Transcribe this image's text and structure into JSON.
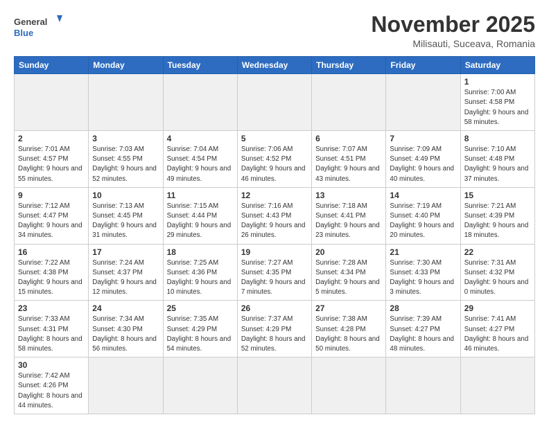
{
  "logo": {
    "text_general": "General",
    "text_blue": "Blue"
  },
  "header": {
    "month": "November 2025",
    "location": "Milisauti, Suceava, Romania"
  },
  "weekdays": [
    "Sunday",
    "Monday",
    "Tuesday",
    "Wednesday",
    "Thursday",
    "Friday",
    "Saturday"
  ],
  "weeks": [
    {
      "days": [
        {
          "num": "",
          "info": ""
        },
        {
          "num": "",
          "info": ""
        },
        {
          "num": "",
          "info": ""
        },
        {
          "num": "",
          "info": ""
        },
        {
          "num": "",
          "info": ""
        },
        {
          "num": "",
          "info": ""
        },
        {
          "num": "1",
          "info": "Sunrise: 7:00 AM\nSunset: 4:58 PM\nDaylight: 9 hours\nand 58 minutes."
        }
      ]
    },
    {
      "days": [
        {
          "num": "2",
          "info": "Sunrise: 7:01 AM\nSunset: 4:57 PM\nDaylight: 9 hours\nand 55 minutes."
        },
        {
          "num": "3",
          "info": "Sunrise: 7:03 AM\nSunset: 4:55 PM\nDaylight: 9 hours\nand 52 minutes."
        },
        {
          "num": "4",
          "info": "Sunrise: 7:04 AM\nSunset: 4:54 PM\nDaylight: 9 hours\nand 49 minutes."
        },
        {
          "num": "5",
          "info": "Sunrise: 7:06 AM\nSunset: 4:52 PM\nDaylight: 9 hours\nand 46 minutes."
        },
        {
          "num": "6",
          "info": "Sunrise: 7:07 AM\nSunset: 4:51 PM\nDaylight: 9 hours\nand 43 minutes."
        },
        {
          "num": "7",
          "info": "Sunrise: 7:09 AM\nSunset: 4:49 PM\nDaylight: 9 hours\nand 40 minutes."
        },
        {
          "num": "8",
          "info": "Sunrise: 7:10 AM\nSunset: 4:48 PM\nDaylight: 9 hours\nand 37 minutes."
        }
      ]
    },
    {
      "days": [
        {
          "num": "9",
          "info": "Sunrise: 7:12 AM\nSunset: 4:47 PM\nDaylight: 9 hours\nand 34 minutes."
        },
        {
          "num": "10",
          "info": "Sunrise: 7:13 AM\nSunset: 4:45 PM\nDaylight: 9 hours\nand 31 minutes."
        },
        {
          "num": "11",
          "info": "Sunrise: 7:15 AM\nSunset: 4:44 PM\nDaylight: 9 hours\nand 29 minutes."
        },
        {
          "num": "12",
          "info": "Sunrise: 7:16 AM\nSunset: 4:43 PM\nDaylight: 9 hours\nand 26 minutes."
        },
        {
          "num": "13",
          "info": "Sunrise: 7:18 AM\nSunset: 4:41 PM\nDaylight: 9 hours\nand 23 minutes."
        },
        {
          "num": "14",
          "info": "Sunrise: 7:19 AM\nSunset: 4:40 PM\nDaylight: 9 hours\nand 20 minutes."
        },
        {
          "num": "15",
          "info": "Sunrise: 7:21 AM\nSunset: 4:39 PM\nDaylight: 9 hours\nand 18 minutes."
        }
      ]
    },
    {
      "days": [
        {
          "num": "16",
          "info": "Sunrise: 7:22 AM\nSunset: 4:38 PM\nDaylight: 9 hours\nand 15 minutes."
        },
        {
          "num": "17",
          "info": "Sunrise: 7:24 AM\nSunset: 4:37 PM\nDaylight: 9 hours\nand 12 minutes."
        },
        {
          "num": "18",
          "info": "Sunrise: 7:25 AM\nSunset: 4:36 PM\nDaylight: 9 hours\nand 10 minutes."
        },
        {
          "num": "19",
          "info": "Sunrise: 7:27 AM\nSunset: 4:35 PM\nDaylight: 9 hours\nand 7 minutes."
        },
        {
          "num": "20",
          "info": "Sunrise: 7:28 AM\nSunset: 4:34 PM\nDaylight: 9 hours\nand 5 minutes."
        },
        {
          "num": "21",
          "info": "Sunrise: 7:30 AM\nSunset: 4:33 PM\nDaylight: 9 hours\nand 3 minutes."
        },
        {
          "num": "22",
          "info": "Sunrise: 7:31 AM\nSunset: 4:32 PM\nDaylight: 9 hours\nand 0 minutes."
        }
      ]
    },
    {
      "days": [
        {
          "num": "23",
          "info": "Sunrise: 7:33 AM\nSunset: 4:31 PM\nDaylight: 8 hours\nand 58 minutes."
        },
        {
          "num": "24",
          "info": "Sunrise: 7:34 AM\nSunset: 4:30 PM\nDaylight: 8 hours\nand 56 minutes."
        },
        {
          "num": "25",
          "info": "Sunrise: 7:35 AM\nSunset: 4:29 PM\nDaylight: 8 hours\nand 54 minutes."
        },
        {
          "num": "26",
          "info": "Sunrise: 7:37 AM\nSunset: 4:29 PM\nDaylight: 8 hours\nand 52 minutes."
        },
        {
          "num": "27",
          "info": "Sunrise: 7:38 AM\nSunset: 4:28 PM\nDaylight: 8 hours\nand 50 minutes."
        },
        {
          "num": "28",
          "info": "Sunrise: 7:39 AM\nSunset: 4:27 PM\nDaylight: 8 hours\nand 48 minutes."
        },
        {
          "num": "29",
          "info": "Sunrise: 7:41 AM\nSunset: 4:27 PM\nDaylight: 8 hours\nand 46 minutes."
        }
      ]
    },
    {
      "days": [
        {
          "num": "30",
          "info": "Sunrise: 7:42 AM\nSunset: 4:26 PM\nDaylight: 8 hours\nand 44 minutes."
        },
        {
          "num": "",
          "info": ""
        },
        {
          "num": "",
          "info": ""
        },
        {
          "num": "",
          "info": ""
        },
        {
          "num": "",
          "info": ""
        },
        {
          "num": "",
          "info": ""
        },
        {
          "num": "",
          "info": ""
        }
      ]
    }
  ]
}
